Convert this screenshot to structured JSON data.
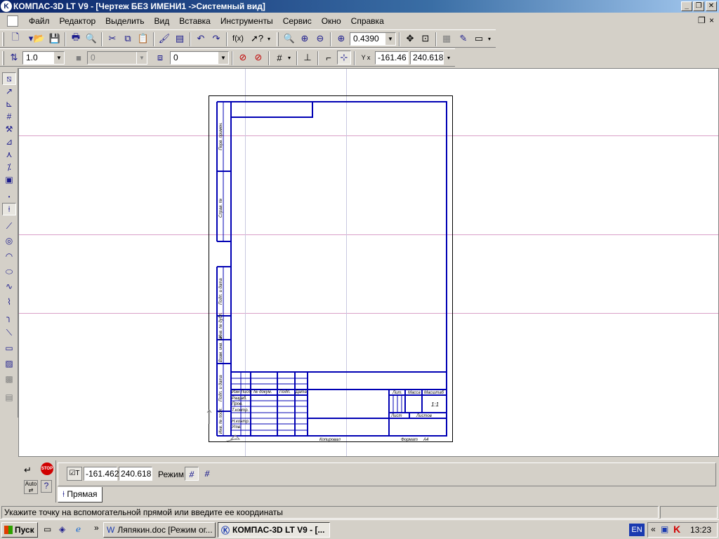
{
  "window": {
    "title": "КОМПАС-3D LT V9 - [Чертеж БЕЗ ИМЕНИ1 ->Системный вид]",
    "app_icon": "K",
    "min": "_",
    "restore": "❐",
    "close": "✕"
  },
  "menu": {
    "items": [
      "Файл",
      "Редактор",
      "Выделить",
      "Вид",
      "Вставка",
      "Инструменты",
      "Сервис",
      "Окно",
      "Справка"
    ],
    "doc_restore": "❐",
    "doc_close": "×"
  },
  "toolbar1": {
    "zoom_value": "0.4390",
    "fx_label": "f(x)"
  },
  "toolbar2": {
    "scale_value": "1.0",
    "style_value": "0",
    "layer_value": "0",
    "coord_x": "-161.46",
    "coord_y": "240.618",
    "xy_label": "Y x"
  },
  "drawing": {
    "stamp_cells": {
      "izm": "Изм",
      "list": "Лист",
      "doc_no": "№ докум.",
      "podp": "Подп.",
      "data": "Дата",
      "razrab": "Разраб.",
      "prov": "Пров.",
      "tkontr": "Т.контр.",
      "nkontr": "Н.контр.",
      "utv": "Утв.",
      "lit": "Лит.",
      "massa": "Масса",
      "masshtab": "Масштаб",
      "masshtab_value": "1:1",
      "list2": "Лист",
      "listov": "Листов",
      "kopiroval": "Копировал",
      "format": "Формат",
      "format_value": "A4"
    },
    "side_labels": [
      "Перв. примен.",
      "Справ. №",
      "Подп. и дата",
      "Инв. № дубл.",
      "Взам. инв. №",
      "Подп. и дата",
      "Инв. № подл."
    ]
  },
  "propbar": {
    "coord_x": "-161.462",
    "coord_y": "240.618",
    "mode_label": "Режим",
    "tab_label": "Прямая",
    "auto_label": "Auto",
    "stop_label": "STOP"
  },
  "status": {
    "message": "Укажите точку на вспомогательной прямой или введите ее координаты"
  },
  "taskbar": {
    "start_label": "Пуск",
    "chevron": "»",
    "task1": "Ляпякин.doc [Режим ог...",
    "task2": "КОМПАС-3D LT V9 - [...",
    "lang": "EN",
    "tray_chevron": "«",
    "clock": "13:23"
  },
  "colors": {
    "frame_blue": "#0000b4",
    "guide_line": "#d9a0c8",
    "title_bar_start": "#0a246a",
    "title_bar_end": "#a6caf0"
  }
}
